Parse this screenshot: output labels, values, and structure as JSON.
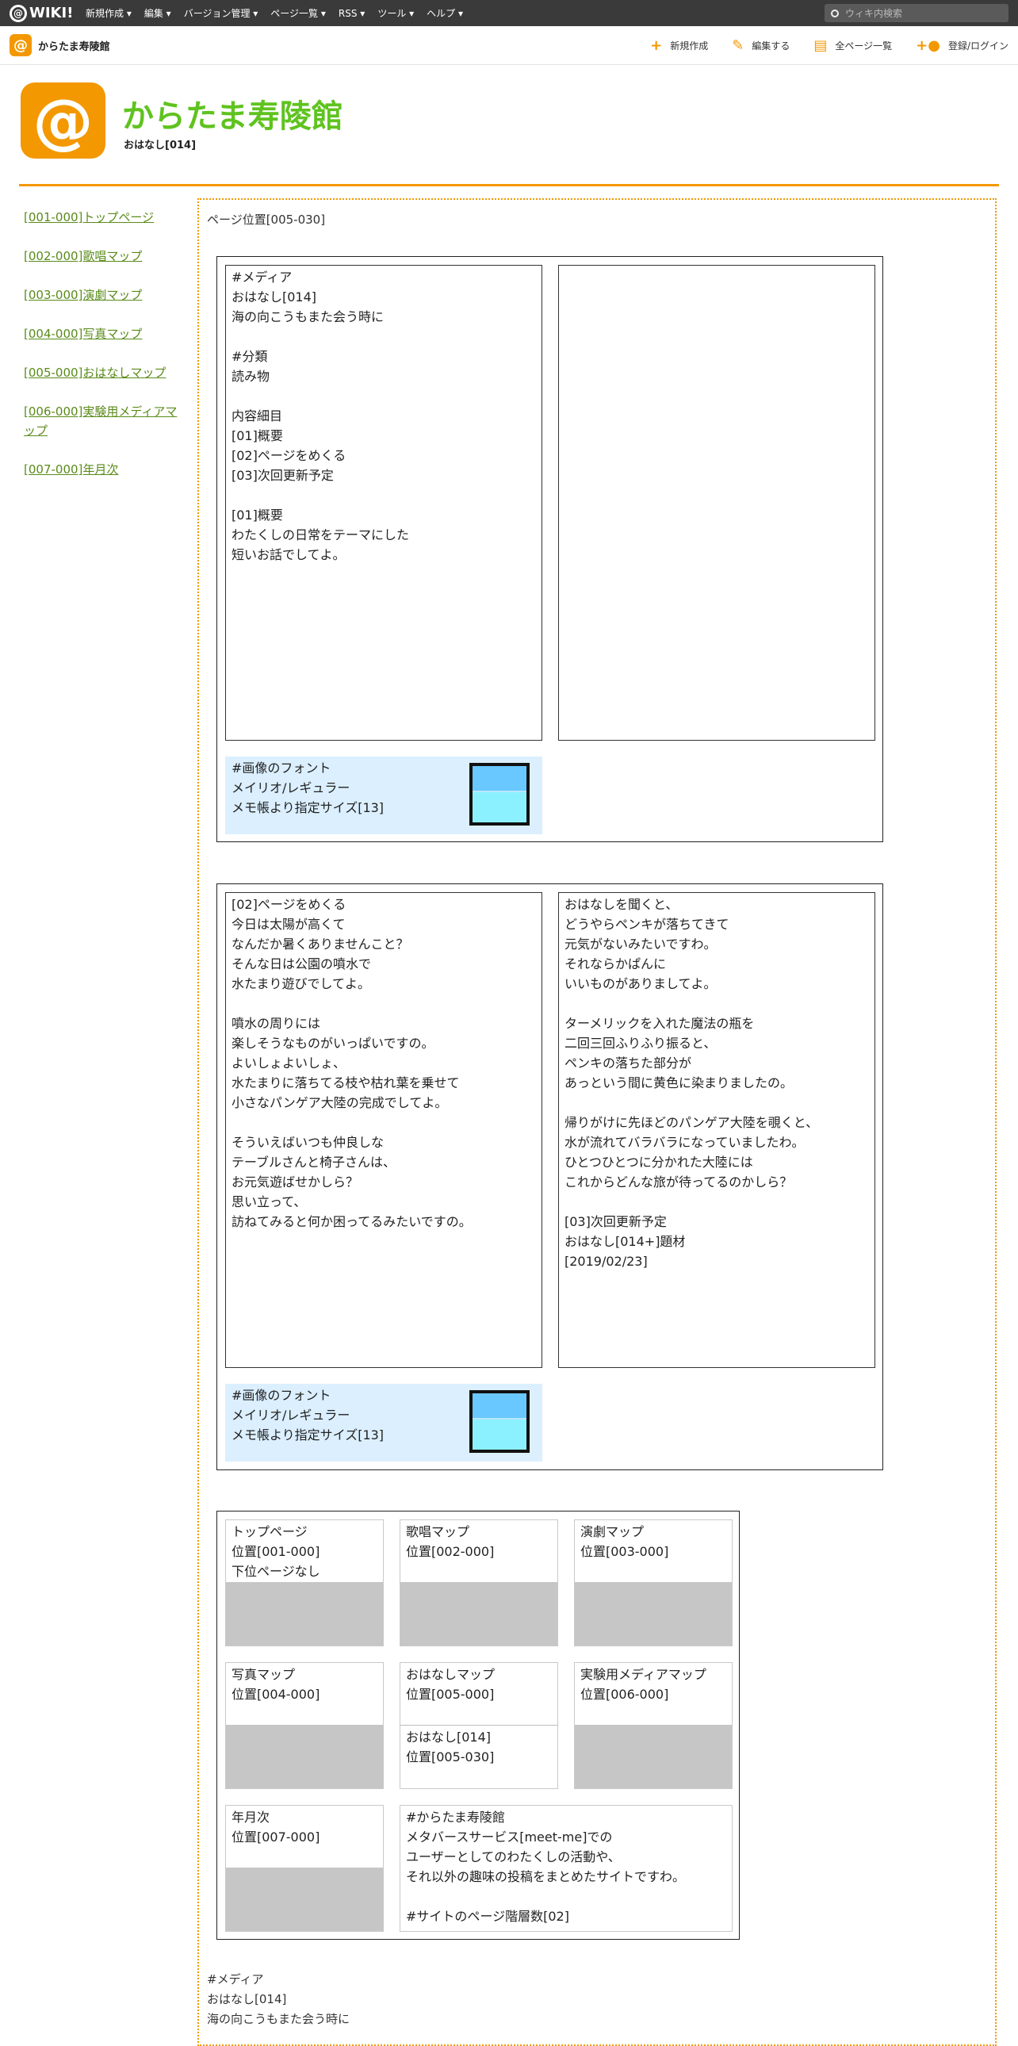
{
  "topbar": {
    "logo": "WIKI!",
    "menus": [
      "新規作成 ▾",
      "編集 ▾",
      "バージョン管理 ▾",
      "ページ一覧 ▾",
      "RSS ▾",
      "ツール ▾",
      "ヘルプ ▾"
    ],
    "search_placeholder": "ウィキ内検索"
  },
  "subbar": {
    "site_name": "からたま寿陵館",
    "actions": [
      {
        "icon": "plus-icon",
        "label": "新規作成"
      },
      {
        "icon": "pencil-icon",
        "label": "編集する"
      },
      {
        "icon": "document-icon",
        "label": "全ページ一覧"
      },
      {
        "icon": "user-add-icon",
        "label": "登録/ログイン"
      }
    ]
  },
  "header": {
    "title": "からたま寿陵館",
    "subtitle": "おはなし[014]"
  },
  "sidebar": {
    "links": [
      "[001-000]トップページ",
      "[002-000]歌唱マップ",
      "[003-000]演劇マップ",
      "[004-000]写真マップ",
      "[005-000]おはなしマップ",
      "[006-000]実験用メディアマップ",
      "[007-000]年月次"
    ]
  },
  "content": {
    "position": "ページ位置[005-030]",
    "section1": {
      "left_text": "#メディア\nおはなし[014]\n海の向こうもまた会う時に\n\n#分類\n読み物\n\n内容細目\n[01]概要\n[02]ページをめくる\n[03]次回更新予定\n\n[01]概要\nわたくしの日常をテーマにした\n短いお話でしてよ。",
      "right_text": "",
      "note": "#画像のフォント\nメイリオ/レギュラー\nメモ帳より指定サイズ[13]"
    },
    "section2": {
      "left_text": "[02]ページをめくる\n今日は太陽が高くて\nなんだか暑くありませんこと？\nそんな日は公園の噴水で\n水たまり遊びでしてよ。\n\n噴水の周りには\n楽しそうなものがいっぱいですの。\nよいしょよいしょ、\n水たまりに落ちてる枝や枯れ葉を乗せて\n小さなパンゲア大陸の完成でしてよ。\n\nそういえばいつも仲良しな\nテーブルさんと椅子さんは、\nお元気遊ばせかしら？\n思い立って、\n訪ねてみると何か困ってるみたいですの。",
      "right_text": "おはなしを聞くと、\nどうやらペンキが落ちてきて\n元気がないみたいですわ。\nそれならかぱんに\nいいものがありましてよ。\n\nターメリックを入れた魔法の瓶を\n二回三回ふりふり振ると、\nペンキの落ちた部分が\nあっという間に黄色に染まりましたの。\n\n帰りがけに先ほどのパンゲア大陸を覗くと、\n水が流れてバラバラになっていましたわ。\nひとつひとつに分かれた大陸には\nこれからどんな旅が待ってるのかしら？\n\n[03]次回更新予定\nおはなし[014+]題材\n[2019/02/23]",
      "note": "#画像のフォント\nメイリオ/レギュラー\nメモ帳より指定サイズ[13]"
    },
    "nav_cards": [
      {
        "text": "トップページ\n位置[001-000]\n下位ページなし"
      },
      {
        "text": "歌唱マップ\n位置[002-000]"
      },
      {
        "text": "演劇マップ\n位置[003-000]"
      },
      {
        "text": "写真マップ\n位置[004-000]"
      },
      {
        "text": "おはなしマップ\n位置[005-000]",
        "sub": "おはなし[014]\n位置[005-030]"
      },
      {
        "text": "実験用メディアマップ\n位置[006-000]"
      },
      {
        "text": "年月次\n位置[007-000]"
      }
    ],
    "about": "#からたま寿陵館\nメタバースサービス[meet-me]での\nユーザーとしてのわたくしの活動や、\nそれ以外の趣味の投稿をまとめたサイトですわ。\n\n#サイトのページ階層数[02]",
    "footer": "#メディア\nおはなし[014]\n海の向こうもまた会う時に"
  }
}
